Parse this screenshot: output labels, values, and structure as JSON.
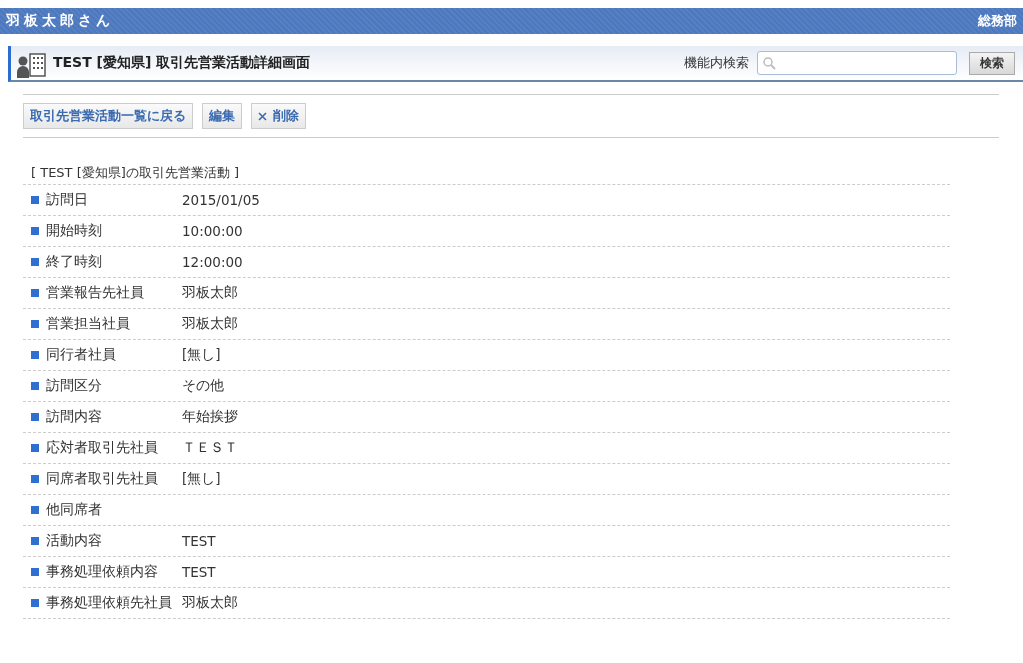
{
  "header": {
    "user": "羽板太郎さん",
    "department": "総務部"
  },
  "title_bar": {
    "title": "TEST [愛知県] 取引先営業活動詳細画面",
    "search_label": "機能内検索",
    "search_button": "検索"
  },
  "actions": [
    "取引先営業活動一覧に戻る",
    "編集",
    "削除"
  ],
  "section_title": "[ TEST [愛知県]の取引先営業活動 ]",
  "fields": [
    {
      "label": "訪問日",
      "value": "2015/01/05"
    },
    {
      "label": "開始時刻",
      "value": "10:00:00"
    },
    {
      "label": "終了時刻",
      "value": "12:00:00"
    },
    {
      "label": "営業報告先社員",
      "value": "羽板太郎"
    },
    {
      "label": "営業担当社員",
      "value": "羽板太郎"
    },
    {
      "label": "同行者社員",
      "value": "[無し]"
    },
    {
      "label": "訪問区分",
      "value": "その他"
    },
    {
      "label": "訪問内容",
      "value": "年始挨拶"
    },
    {
      "label": "応対者取引先社員",
      "value": "ＴＥＳＴ"
    },
    {
      "label": "同席者取引先社員",
      "value": "[無し]"
    },
    {
      "label": "他同席者"
    },
    {
      "label": "活動内容",
      "value": "TEST"
    },
    {
      "label": "事務処理依頼内容",
      "value": "TEST"
    },
    {
      "label": "事務処理依頼先社員",
      "value": "羽板太郎"
    }
  ]
}
